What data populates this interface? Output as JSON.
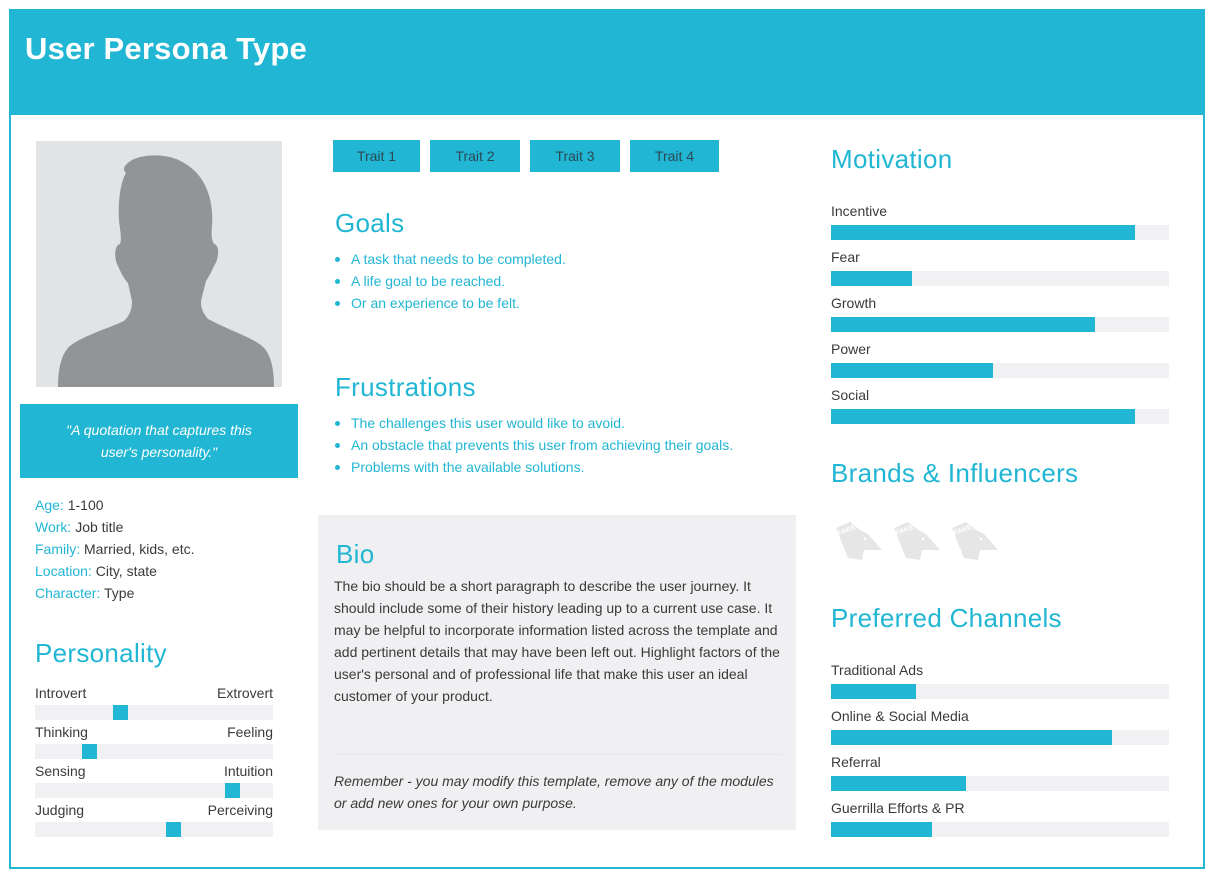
{
  "header": {
    "title": "User Persona Type"
  },
  "profile": {
    "photo_icon": "person-silhouette-icon",
    "quote": "\"A quotation that captures this user's personality.\"",
    "facts": [
      {
        "key": "Age:",
        "value": "1-100"
      },
      {
        "key": "Work:",
        "value": "Job title"
      },
      {
        "key": "Family:",
        "value": "Married, kids, etc."
      },
      {
        "key": "Location:",
        "value": "City, state"
      },
      {
        "key": "Character:",
        "value": "Type"
      }
    ]
  },
  "personality": {
    "title": "Personality",
    "scales": [
      {
        "left": "Introvert",
        "right": "Extrovert",
        "position": 0.36
      },
      {
        "left": "Thinking",
        "right": "Feeling",
        "position": 0.23
      },
      {
        "left": "Sensing",
        "right": "Intuition",
        "position": 0.83
      },
      {
        "left": "Judging",
        "right": "Perceiving",
        "position": 0.58
      }
    ]
  },
  "traits": [
    "Trait 1",
    "Trait 2",
    "Trait 3",
    "Trait 4"
  ],
  "goals": {
    "title": "Goals",
    "items": [
      "A task that needs to be completed.",
      "A life goal to be reached.",
      "Or an experience to be felt."
    ]
  },
  "frustrations": {
    "title": "Frustrations",
    "items": [
      "The challenges this user would like to avoid.",
      "An obstacle that prevents this user from achieving their goals.",
      "Problems with the available solutions."
    ]
  },
  "bio": {
    "title": "Bio",
    "text": "The bio should be a short paragraph to describe the user journey. It should include some of their history leading up to a current use case. It may be helpful to incorporate information listed across the template and add pertinent details that may have been left out. Highlight factors of the user's personal and of professional life that make this user an ideal customer of your product.",
    "note": "Remember - you may modify this template, remove any of the modules or add new ones for your own purpose."
  },
  "motivation": {
    "title": "Motivation",
    "items": [
      {
        "label": "Incentive",
        "value": 0.9
      },
      {
        "label": "Fear",
        "value": 0.24
      },
      {
        "label": "Growth",
        "value": 0.78
      },
      {
        "label": "Power",
        "value": 0.48
      },
      {
        "label": "Social",
        "value": 0.9
      }
    ]
  },
  "brands": {
    "title": "Brands & Influencers",
    "logos": [
      {
        "text": "FAKE CROW",
        "icon": "fake-crow-logo-icon"
      },
      {
        "text": "FAKE CROW",
        "icon": "fake-crow-logo-icon"
      },
      {
        "text": "FAKE CROW",
        "icon": "fake-crow-logo-icon"
      }
    ]
  },
  "channels": {
    "title": "Preferred Channels",
    "items": [
      {
        "label": "Traditional Ads",
        "value": 0.25
      },
      {
        "label": "Online & Social Media",
        "value": 0.83
      },
      {
        "label": "Referral",
        "value": 0.4
      },
      {
        "label": "Guerrilla Efforts & PR",
        "value": 0.3
      }
    ]
  },
  "colors": {
    "accent": "#21b6d3",
    "track": "#f1f1f3",
    "bio_bg": "#f0f0f2",
    "photo_bg": "#e2e3e5",
    "silhouette": "#929598"
  }
}
